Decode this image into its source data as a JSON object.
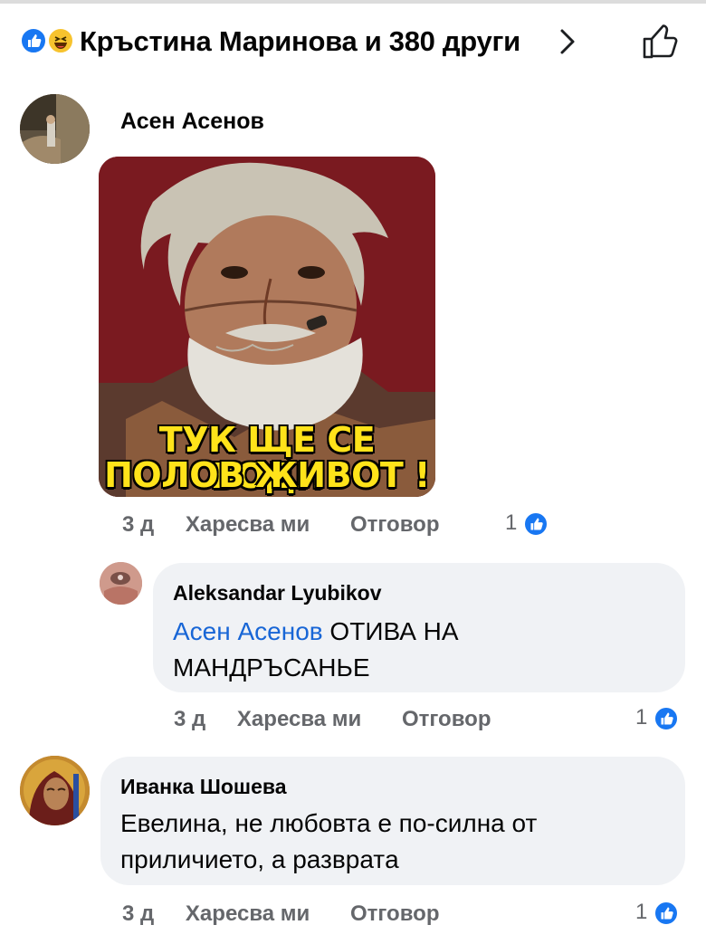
{
  "header": {
    "reaction_icons": [
      "like-icon",
      "haha-icon"
    ],
    "reactors_text": "Кръстина Маринова и 380 други",
    "chevron_icon": "chevron-right-icon",
    "like_outline_icon": "thumbs-up-outline-icon"
  },
  "comments": [
    {
      "author": "Асен Асенов",
      "image_caption": [
        "ТУК ЩЕ СЕ ВОДИ",
        "ПОЛОВ ЖИВОТ !"
      ],
      "time": "3 д",
      "like_label": "Харесва ми",
      "reply_label": "Отговор",
      "reaction_count": "1",
      "reply": {
        "author": "Aleksandar Lyubikov",
        "mention": "Асен Асенов",
        "text": " ОТИВА НА МАНДРЪСАНЬЕ",
        "time": "3 д",
        "like_label": "Харесва ми",
        "reply_label": "Отговор",
        "reaction_count": "1"
      }
    },
    {
      "author": "Иванка Шошева",
      "text": "Евелина, не любовта е по-силна от приличието, а развратa",
      "time": "3 д",
      "like_label": "Харесва ми",
      "reply_label": "Отговор",
      "reaction_count": "1"
    }
  ],
  "colors": {
    "accent": "#1877f2",
    "mention": "#1866d6",
    "meta": "#65676b",
    "bubble": "#f0f2f5",
    "caption": "#ffe31a"
  }
}
